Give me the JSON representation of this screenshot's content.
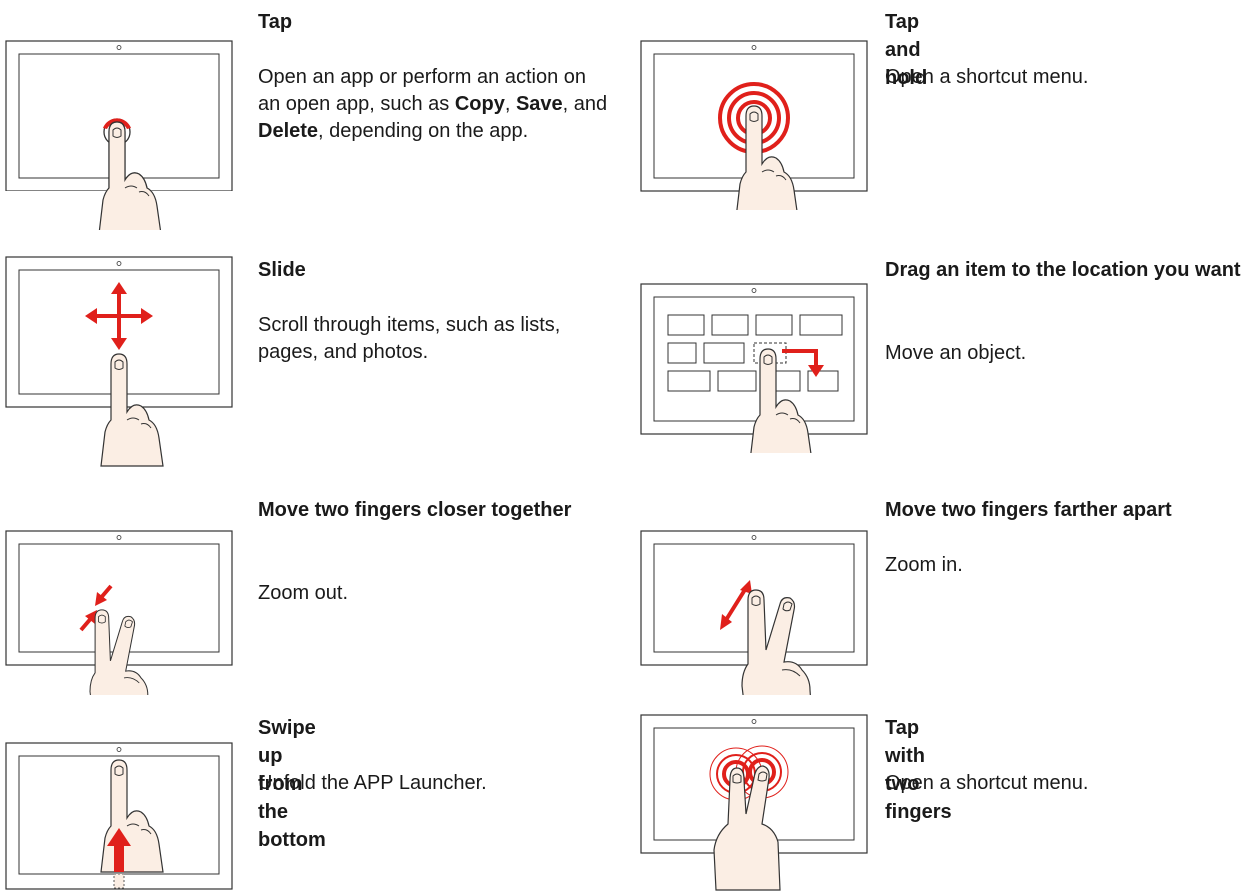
{
  "colors": {
    "accent": "#e0201b",
    "skin": "#fbeee4",
    "outline": "#333333"
  },
  "gestures": [
    {
      "id": "tap",
      "title": "Tap",
      "desc_parts": [
        "Open an app or perform an action on an open app, such as ",
        "Copy",
        ", ",
        "Save",
        ", and ",
        "Delete",
        ", depending on the app."
      ]
    },
    {
      "id": "tap-hold",
      "title": "Tap and hold",
      "desc": "Open a shortcut menu."
    },
    {
      "id": "slide",
      "title": "Slide",
      "desc": "Scroll through items, such as lists, pages, and photos."
    },
    {
      "id": "drag",
      "title": "Drag an item to the location you want",
      "desc": "Move an object."
    },
    {
      "id": "pinch",
      "title": "Move two fingers closer together",
      "desc": "Zoom out."
    },
    {
      "id": "spread",
      "title": "Move two fingers farther apart",
      "desc": "Zoom in."
    },
    {
      "id": "swipe-up",
      "title": "Swipe up from the bottom",
      "desc": "Unfold the APP Launcher."
    },
    {
      "id": "two-finger-tap",
      "title": "Tap with two fingers",
      "desc": "Open a shortcut menu."
    }
  ]
}
